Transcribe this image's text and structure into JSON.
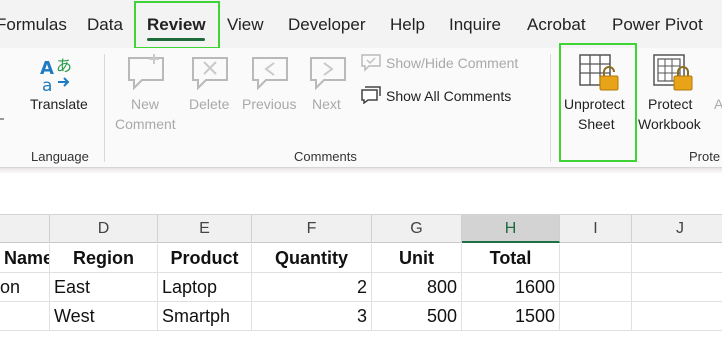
{
  "ribbon_tabs": [
    "Formulas",
    "Data",
    "Review",
    "View",
    "Developer",
    "Help",
    "Inquire",
    "Acrobat",
    "Power Pivot"
  ],
  "active_tab": "Review",
  "colors": {
    "accent_green": "#1e6b3c",
    "highlight_box": "#3fd436",
    "lock_gold": "#e8a319"
  },
  "language_group": {
    "label": "Language",
    "translate": {
      "label": "Translate",
      "icon": "translate-icon"
    }
  },
  "comments_group": {
    "label": "Comments",
    "new_comment": {
      "line1": "New",
      "line2": "Comment",
      "icon": "new-comment-icon",
      "enabled": false
    },
    "delete": {
      "label": "Delete",
      "icon": "delete-comment-icon",
      "enabled": false
    },
    "previous": {
      "label": "Previous",
      "icon": "previous-comment-icon",
      "enabled": false
    },
    "next": {
      "label": "Next",
      "icon": "next-comment-icon",
      "enabled": false
    },
    "show_hide": {
      "label": "Show/Hide Comment",
      "icon": "show-hide-comment-icon",
      "enabled": false
    },
    "show_all": {
      "label": "Show All Comments",
      "icon": "show-all-comments-icon",
      "enabled": true
    }
  },
  "protect_group": {
    "label_partial": "Prote",
    "unprotect_sheet": {
      "line1": "Unprotect",
      "line2": "Sheet",
      "icon": "unprotect-sheet-icon"
    },
    "protect_workbook": {
      "line1": "Protect",
      "line2": "Workbook",
      "icon": "protect-workbook-icon"
    },
    "cutoff_label": "A"
  },
  "columns": [
    "D",
    "E",
    "F",
    "G",
    "H",
    "I",
    "J"
  ],
  "selected_column": "H",
  "table": {
    "headers": [
      "Name",
      "Region",
      "Product",
      "Quantity",
      "Unit",
      "Total"
    ],
    "rows": [
      [
        "on",
        "East",
        "Laptop",
        "2",
        "800",
        "1600"
      ],
      [
        "",
        "West",
        "Smartph",
        "3",
        "500",
        "1500"
      ]
    ]
  }
}
